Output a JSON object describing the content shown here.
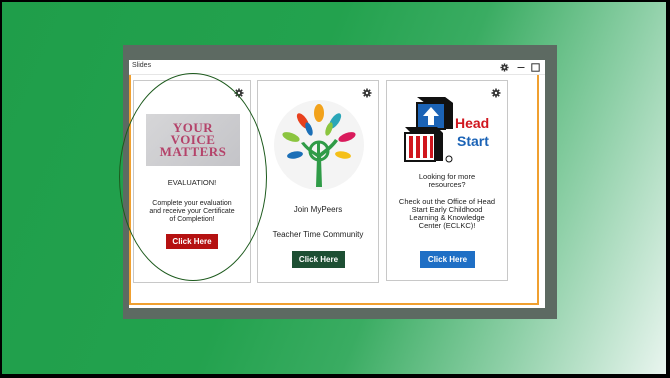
{
  "window": {
    "title": "Slides"
  },
  "colors": {
    "background_green": "#1f9e4a",
    "frame_gray": "#5d6a62",
    "accent_orange": "#f0a030",
    "btn_red": "#b51111",
    "btn_dark_green": "#1d4f33",
    "btn_blue": "#1f6fc5",
    "ellipse": "#1d5a1d"
  },
  "cards": [
    {
      "image_text": "YOUR VOICE MATTERS",
      "heading": "EVALUATION!",
      "description": "Complete your evaluation and receive your Certificate of Completion!",
      "button": "Click Here"
    },
    {
      "heading": "Join MyPeers",
      "subheading": "Teacher Time Community",
      "button": "Click Here"
    },
    {
      "logo_text_1": "Head",
      "logo_text_2": "Start",
      "question": "Looking for more resources?",
      "description": "Check out the Office of Head Start Early Childhood Learning & Knowledge Center (ECLKC)!",
      "button": "Click Here"
    }
  ]
}
